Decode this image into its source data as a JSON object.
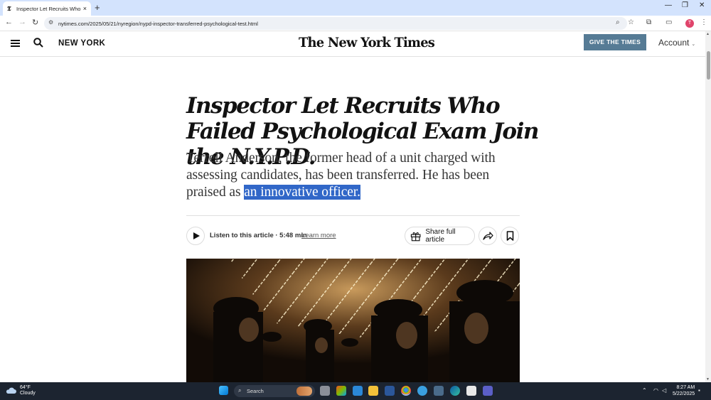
{
  "browser": {
    "tab_title": "Inspector Let Recruits Who Fa",
    "favicon_glyph": "𝕿",
    "tab_close": "×",
    "new_tab": "+",
    "url": "nytimes.com/2025/05/21/nyregion/nypd-inspector-transferred-psychological-test.html",
    "profile_initial": "T",
    "window_controls": [
      "—",
      "❐",
      "✕"
    ]
  },
  "header": {
    "section": "NEW YORK",
    "logo": "The New York Times",
    "give_button": "GIVE THE TIMES",
    "account": "Account"
  },
  "article": {
    "headline": "Inspector Let Recruits Who Failed Psychological Exam Join the N.Y.P.D.",
    "summary_plain": "Terrell Anderson, the former head of a unit charged with assessing candidates, has been transferred. He has been praised as ",
    "summary_selected": "an innovative officer.",
    "listen": "Listen to this article · 5:48 min",
    "learn_more": "Learn more",
    "share": "Share full article"
  },
  "taskbar": {
    "temperature": "64°F",
    "condition": "Cloudy",
    "search_placeholder": "Search",
    "time": "8:27 AM",
    "date": "5/22/2025"
  },
  "colors": {
    "tab_strip": "#d3e3fd",
    "give_button": "#567b95",
    "selection": "#3167c8",
    "taskbar": "#1c2430"
  }
}
